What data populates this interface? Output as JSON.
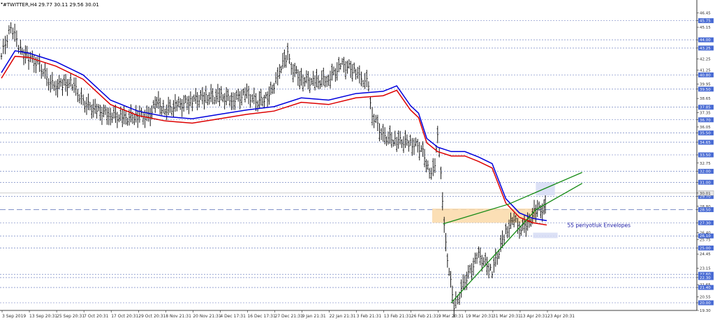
{
  "chart_data": {
    "type": "line",
    "title": "#TWITTER,H4  29.77 30.11 29.56 30.01",
    "ylim": [
      19.3,
      47.0
    ],
    "x": [
      "3 Sep 2019",
      "13 Sep 20:31",
      "25 Sep 20:31",
      "7 Oct 20:31",
      "17 Oct 20:31",
      "29 Oct 20:31",
      "8 Nov 21:31",
      "20 Nov 21:31",
      "4 Dec 17:31",
      "16 Dec 17:31",
      "27 Dec 21:31",
      "9 Jan 21:31",
      "22 Jan 21:31",
      "3 Feb 21:31",
      "13 Feb 21:31",
      "26 Feb 21:31",
      "9 Mar 20:31",
      "19 Mar 20:31",
      "31 Mar 20:31",
      "13 Apr 20:31",
      "23 Apr 20:31"
    ],
    "y_ticks": [
      "46.45",
      "45.75",
      "45.15",
      "44.00",
      "43.25",
      "42.25",
      "41.25",
      "40.80",
      "39.95",
      "39.50",
      "38.65",
      "37.85",
      "37.35",
      "36.70",
      "36.05",
      "35.50",
      "34.65",
      "33.50",
      "32.75",
      "32.00",
      "31.00",
      "30.01",
      "29.70",
      "28.80",
      "28.50",
      "27.30",
      "26.40",
      "26.10",
      "25.75",
      "25.00",
      "24.45",
      "23.15",
      "22.60",
      "22.30",
      "21.65",
      "21.40",
      "20.55",
      "20.00",
      "19.30"
    ],
    "highlighted_ticks": [
      "45.75",
      "44.00",
      "43.25",
      "40.80",
      "39.50",
      "37.85",
      "36.70",
      "35.50",
      "34.65",
      "33.50",
      "32.00",
      "31.00",
      "30.01",
      "29.70",
      "28.50",
      "27.30",
      "26.10",
      "25.00",
      "22.60",
      "22.30",
      "21.40",
      "20.00"
    ],
    "current_price": 30.01,
    "horizontal_levels": [
      45.75,
      44.0,
      43.25,
      40.8,
      39.5,
      37.85,
      36.7,
      35.5,
      34.65,
      33.5,
      32.0,
      31.0,
      29.7,
      27.3,
      26.1,
      25.0,
      22.6,
      22.3,
      21.4,
      20.0
    ],
    "dashed_level": 28.5,
    "series": [
      {
        "name": "price",
        "style": "ohlc-bars",
        "color": "#000000",
        "x_index": [
          0,
          0.35,
          0.7,
          1,
          1.4,
          1.8,
          2,
          2.3,
          2.6,
          3,
          3.5,
          4,
          4.5,
          5,
          5.4,
          5.7,
          6,
          6.5,
          7,
          7.5,
          8,
          8.5,
          9,
          9.4,
          9.7,
          10,
          10.2,
          10.5,
          10.7,
          11,
          11.5,
          12,
          12.5,
          13,
          13.2,
          13.4,
          13.6,
          14,
          14.5,
          15,
          15.4,
          15.7,
          15.9,
          16,
          16.3,
          16.6,
          17,
          17.5,
          18,
          18.5,
          18.8,
          19,
          19.3,
          19.6,
          19.9,
          20
        ],
        "values": [
          42.5,
          45.3,
          43.0,
          42.4,
          41.7,
          40.0,
          39.8,
          40.0,
          40.0,
          38.3,
          37.5,
          37.2,
          36.8,
          37.1,
          37.0,
          38.3,
          37.6,
          38.0,
          38.5,
          38.8,
          38.8,
          38.6,
          39.0,
          38.3,
          38.7,
          39.6,
          41.3,
          42.6,
          41.3,
          40.4,
          40.1,
          40.5,
          41.7,
          41.2,
          40.2,
          40.5,
          37.2,
          35.2,
          34.8,
          34.6,
          34.1,
          32.0,
          32.2,
          35.7,
          25.3,
          19.5,
          22.0,
          24.3,
          22.9,
          26.5,
          27.6,
          26.8,
          27.1,
          28.5,
          28.5,
          30.0
        ]
      },
      {
        "name": "",
        "style": "line",
        "color": "#0000dd",
        "x_index": [
          0,
          0.5,
          1,
          2,
          3,
          4,
          5,
          6,
          7,
          8,
          9,
          10,
          11,
          12,
          13,
          14,
          14.5,
          15,
          15.3,
          15.6,
          16,
          16.5,
          17,
          17.5,
          18,
          18.5,
          19,
          19.5,
          20
        ],
        "values": [
          41.0,
          43.0,
          42.8,
          42.0,
          40.8,
          38.5,
          37.5,
          37.0,
          36.8,
          37.2,
          37.6,
          37.9,
          38.7,
          38.5,
          39.1,
          39.3,
          39.8,
          38.0,
          37.3,
          35.0,
          34.2,
          33.8,
          33.8,
          33.3,
          32.7,
          29.5,
          28.2,
          27.7,
          27.5
        ]
      },
      {
        "name": "",
        "style": "line",
        "color": "#dd0000",
        "x_index": [
          0,
          0.5,
          1,
          2,
          3,
          4,
          5,
          6,
          7,
          8,
          9,
          10,
          11,
          12,
          13,
          14,
          14.5,
          15,
          15.3,
          15.6,
          16,
          16.5,
          17,
          17.5,
          18,
          18.5,
          19,
          19.5,
          20
        ],
        "values": [
          40.5,
          42.5,
          42.4,
          41.6,
          40.4,
          38.1,
          37.1,
          36.6,
          36.4,
          36.8,
          37.2,
          37.5,
          38.3,
          38.1,
          38.7,
          38.9,
          39.4,
          37.6,
          36.9,
          34.6,
          33.8,
          33.4,
          33.4,
          32.9,
          32.3,
          29.1,
          27.8,
          27.3,
          27.1
        ]
      },
      {
        "name": "",
        "style": "trendline",
        "color": "#138a13",
        "x_index": [
          16.5,
          19.6,
          21.3
        ],
        "values": [
          20.0,
          28.5,
          30.9
        ]
      },
      {
        "name": "",
        "style": "trendline",
        "color": "#138a13",
        "x_index": [
          16.2,
          18.6,
          21.3
        ],
        "values": [
          27.2,
          29.0,
          31.9
        ]
      }
    ],
    "zones": [
      {
        "label": "",
        "x_index": [
          15.8,
          19.6
        ],
        "y": [
          27.3,
          28.6
        ],
        "color": "#fad9a8"
      },
      {
        "label": "",
        "x_index": [
          19.6,
          20.3
        ],
        "y": [
          29.8,
          31.0
        ],
        "color": "#d6dcf5"
      },
      {
        "label": "",
        "x_index": [
          19.5,
          20.4
        ],
        "y": [
          25.9,
          26.4
        ],
        "color": "#d6dcf5"
      }
    ],
    "annotations": [
      {
        "text": "55 periyotluk Envelopes",
        "x_index": 20.5,
        "y": 26.9
      }
    ],
    "grid": "horizontal-dashed"
  }
}
